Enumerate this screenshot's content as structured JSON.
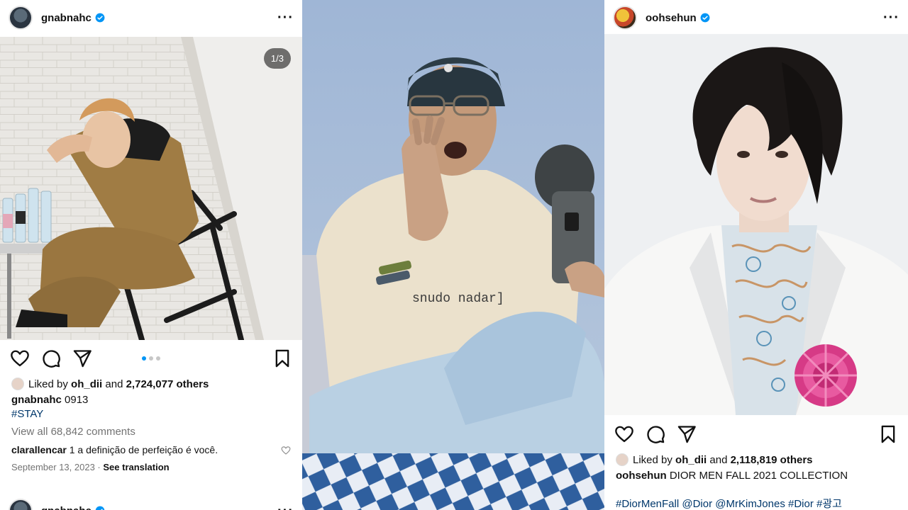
{
  "left_post": {
    "username": "gnabnahc",
    "image_counter": "1/3",
    "liked_prefix": "Liked by ",
    "liked_user": "oh_dii",
    "liked_and": " and ",
    "liked_count": "2,724,077 others",
    "caption_user": "gnabnahc",
    "caption_text": " 0913",
    "hashtag": "#STAY",
    "view_comments": "View all 68,842 comments",
    "comment_user": "clarallencar",
    "comment_text": " 1 a definição de perfeição é você.",
    "date": "September 13, 2023",
    "separator": " · ",
    "see_translation": "See translation",
    "next_username": "gnabnahc"
  },
  "middle_video": {
    "shirt_text": "snudo nadar]"
  },
  "right_post": {
    "username": "oohsehun",
    "liked_prefix": "Liked by ",
    "liked_user": "oh_dii",
    "liked_and": " and ",
    "liked_count": "2,118,819 others",
    "caption_user": "oohsehun",
    "caption_text": " DIOR MEN FALL 2021 COLLECTION",
    "hashtags": "#DiorMenFall @Dior @MrKimJones #Dior #광고"
  },
  "colors": {
    "verified": "#0095f6",
    "hashtag": "#00376b",
    "muted": "#737373"
  }
}
